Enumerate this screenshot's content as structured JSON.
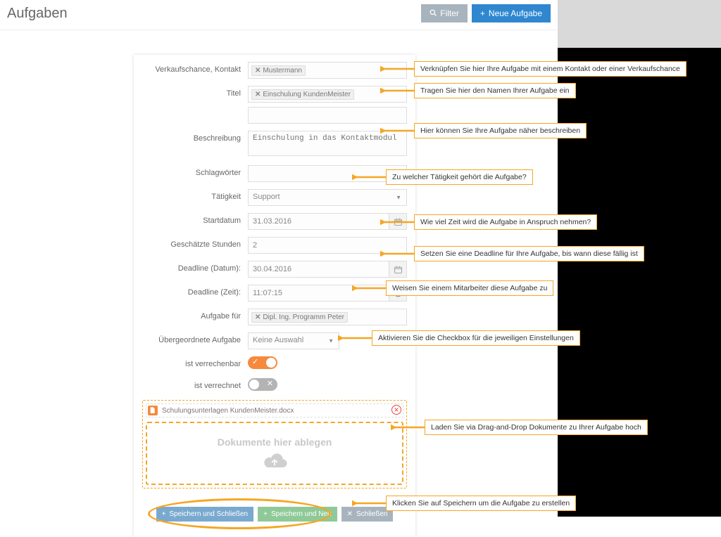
{
  "header": {
    "title": "Aufgaben",
    "filter_label": "Filter",
    "new_label": "Neue Aufgabe"
  },
  "form": {
    "labels": {
      "kontakt": "Verkaufschance, Kontakt",
      "titel": "Titel",
      "beschreibung": "Beschreibung",
      "schlagworter": "Schlagwörter",
      "tatigkeit": "Tätigkeit",
      "startdatum": "Startdatum",
      "stunden": "Geschätzte Stunden",
      "deadline_datum": "Deadline (Datum):",
      "deadline_zeit": "Deadline (Zeit):",
      "aufgabe_fuer": "Aufgabe für",
      "parent": "Übergeordnete Aufgabe",
      "verrechenbar": "ist verrechenbar",
      "verrechnet": "ist verrechnet"
    },
    "values": {
      "kontakt_tag": "Mustermann",
      "titel_tag": "Einschulung KundenMeister",
      "beschreibung_placeholder": "Einschulung in das Kontaktmodul",
      "tatigkeit": "Support",
      "startdatum": "31.03.2016",
      "stunden": "2",
      "deadline_datum": "30.04.2016",
      "deadline_zeit": "11:07:15",
      "aufgabe_fuer_tag": "Dipl. Ing. Programm Peter",
      "parent": "Keine Auswahl",
      "verrechenbar_on": true,
      "verrechnet_on": false
    },
    "attachment": {
      "filename": "Schulungsunterlagen KundenMeister.docx",
      "dropzone_text": "Dokumente hier ablegen"
    },
    "actions": {
      "save_close": "Speichern und Schließen",
      "save_new": "Speichern und Neu",
      "close": "Schließen"
    }
  },
  "callouts": {
    "c1": "Verknüpfen Sie hier Ihre Aufgabe mit einem Kontakt oder einer Verkaufschance",
    "c2": "Tragen Sie hier den Namen Ihrer Aufgabe ein",
    "c3": "Hier können Sie Ihre Aufgabe näher beschreiben",
    "c4": "Zu welcher Tätigkeit gehört die Aufgabe?",
    "c5": "Wie viel Zeit wird die Aufgabe in Anspruch nehmen?",
    "c6": "Setzen Sie eine Deadline für Ihre Aufgabe, bis wann diese fällig ist",
    "c7": "Weisen Sie einem Mitarbeiter diese Aufgabe zu",
    "c8": "Aktivieren Sie die Checkbox für die jeweiligen Einstellungen",
    "c9": "Laden Sie via Drag-and-Drop Dokumente  zu Ihrer Aufgabe hoch",
    "c10": "Klicken Sie auf Speichern um die Aufgabe zu erstellen"
  },
  "icons": {
    "search": "🔍",
    "plus": "+",
    "calendar": "📅",
    "clock": "🕑",
    "check": "✓",
    "cross": "✕",
    "file": "▤",
    "close_x": "×"
  }
}
